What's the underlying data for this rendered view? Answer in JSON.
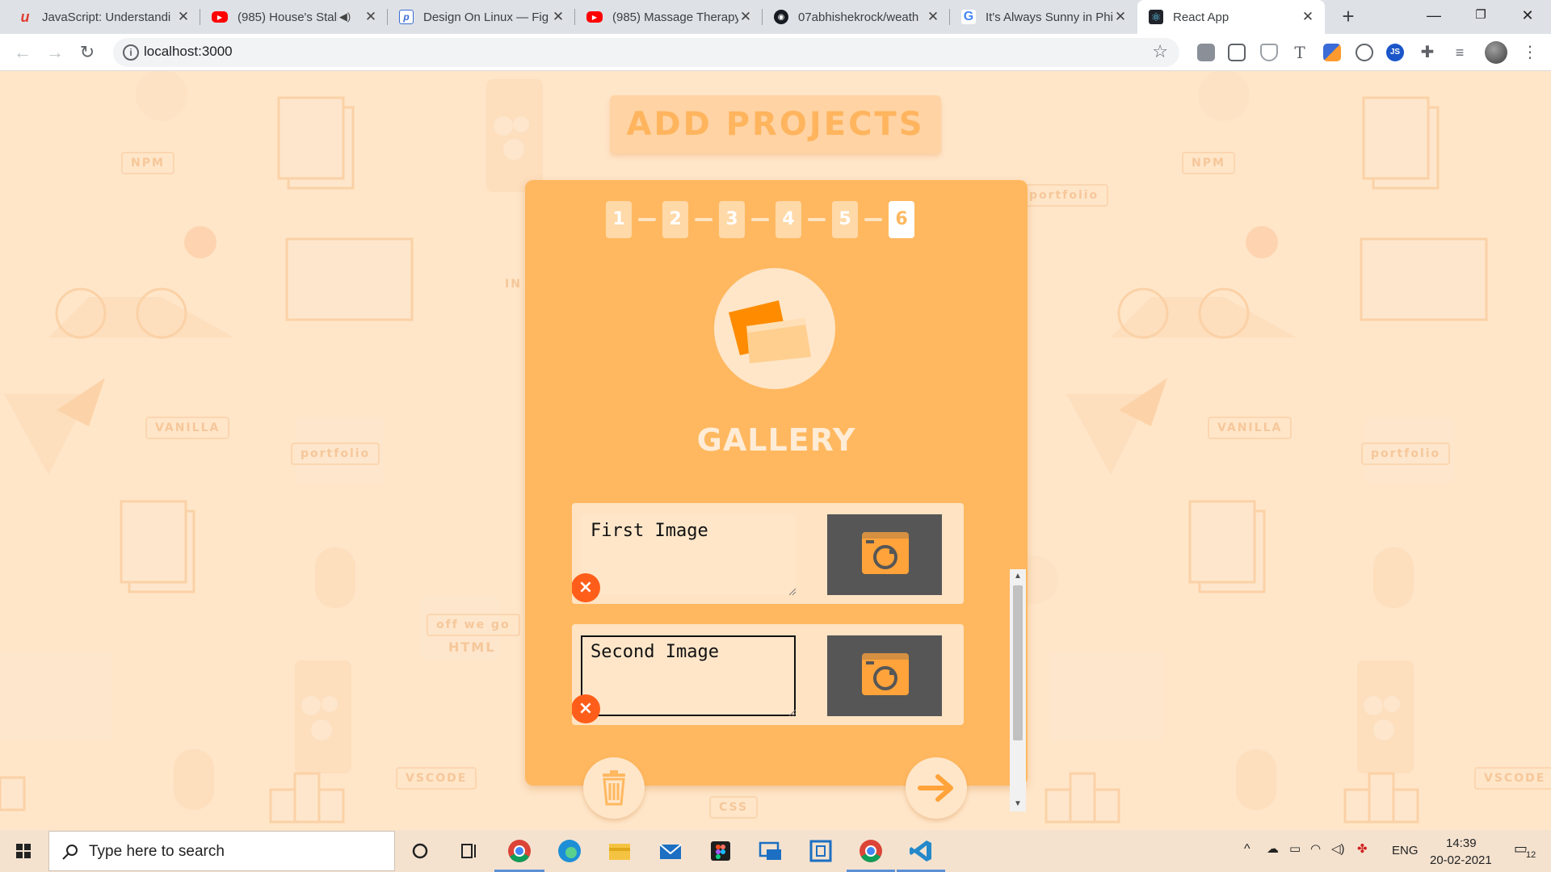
{
  "browser": {
    "tabs": [
      {
        "title": "JavaScript: Understandi",
        "favicon": "udemy-icon",
        "color": "#e03c31",
        "active": false
      },
      {
        "title": "(985) House's Stalk",
        "favicon": "youtube-icon",
        "color": "#ff0000",
        "active": false,
        "muted": true
      },
      {
        "title": "Design On Linux — Fig",
        "favicon": "p-icon",
        "color": "#3b6bd6",
        "active": false
      },
      {
        "title": "(985) Massage Therapy",
        "favicon": "youtube-icon",
        "color": "#ff0000",
        "active": false
      },
      {
        "title": "07abhishekrock/weath",
        "favicon": "github-icon",
        "color": "#161b22",
        "active": false
      },
      {
        "title": "It's Always Sunny in Phi",
        "favicon": "google-icon",
        "color": "#4285f4",
        "active": false
      },
      {
        "title": "React App",
        "favicon": "react-icon",
        "color": "#20232a",
        "active": true
      }
    ],
    "new_tab_label": "+",
    "url": "localhost:3000"
  },
  "page": {
    "heading": "ADD PROJECTS",
    "steps": [
      "1",
      "2",
      "3",
      "4",
      "5",
      "6"
    ],
    "current_step": "6",
    "section_title": "GALLERY",
    "images": [
      {
        "caption": "First Image",
        "focused": false
      },
      {
        "caption": "Second Image",
        "focused": true
      }
    ],
    "remove_label": "×",
    "bg_words": [
      "NPM",
      "portfolio",
      "VANILLA",
      "off we go",
      "HTML",
      "VSCODE",
      "CSS",
      "IN"
    ]
  },
  "taskbar": {
    "search_placeholder": "Type here to search",
    "language": "ENG",
    "time": "14:39",
    "date": "20-02-2021",
    "notification_count": "12"
  },
  "colors": {
    "page_bg": "#ffe6c9",
    "card": "#ffb860",
    "accent_orange": "#ff5e1a",
    "camera_bg": "#565656"
  }
}
